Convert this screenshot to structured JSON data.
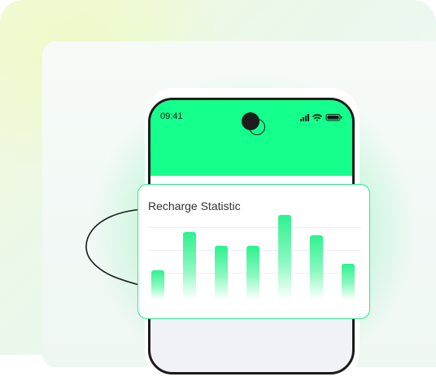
{
  "phone": {
    "status_time": "09:41"
  },
  "card": {
    "title": "Recharge Statistic"
  },
  "chart_data": {
    "type": "bar",
    "title": "Recharge Statistic",
    "categories": [
      "",
      "",
      "",
      "",
      "",
      "",
      ""
    ],
    "values": [
      35,
      82,
      65,
      65,
      102,
      78,
      43
    ],
    "ylim": [
      0,
      110
    ],
    "grid": true,
    "bar_color": "#2df28f"
  },
  "colors": {
    "accent": "#14ff8b",
    "border": "#2de88c"
  }
}
